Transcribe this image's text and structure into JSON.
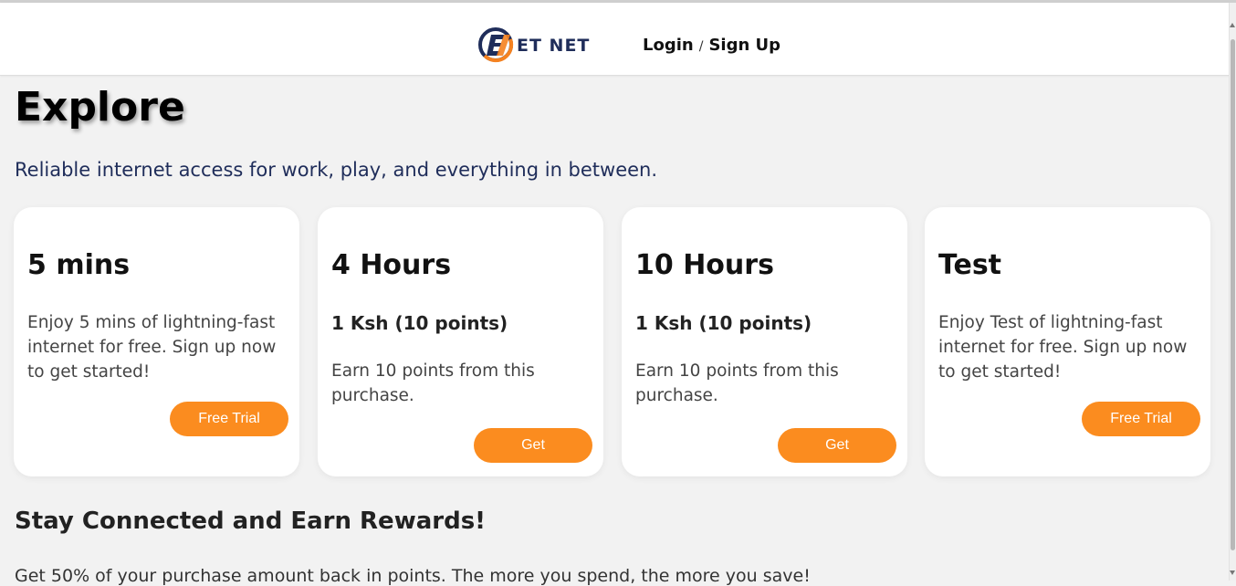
{
  "brand": {
    "name": "ET NET"
  },
  "header": {
    "login_label": "Login",
    "separator": "/",
    "signup_label": "Sign Up"
  },
  "hero": {
    "title": "Explore",
    "subtitle": "Reliable internet access for work, play, and everything in between."
  },
  "plans": [
    {
      "title": "5 mins",
      "price": "",
      "description": "Enjoy 5 mins of lightning-fast internet for free. Sign up now to get started!",
      "button": "Free Trial"
    },
    {
      "title": "4 Hours",
      "price": "1 Ksh (10 points)",
      "description": "Earn 10 points from this purchase.",
      "button": "Get"
    },
    {
      "title": "10 Hours",
      "price": "1 Ksh (10 points)",
      "description": "Earn 10 points from this purchase.",
      "button": "Get"
    },
    {
      "title": "Test",
      "price": "",
      "description": "Enjoy Test of lightning-fast internet for free. Sign up now to get started!",
      "button": "Free Trial"
    }
  ],
  "rewards": {
    "heading": "Stay Connected and Earn Rewards!",
    "text": "Get 50% of your purchase amount back in points. The more you spend, the more you save!"
  },
  "colors": {
    "accent": "#fb8c1f",
    "navy": "#1f2d5a",
    "background": "#f2f2f2",
    "card": "#ffffff"
  }
}
